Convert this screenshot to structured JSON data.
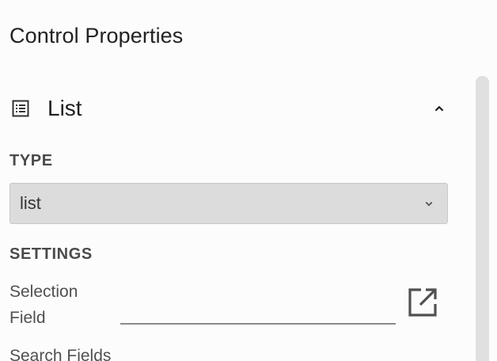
{
  "panel": {
    "title": "Control Properties"
  },
  "section": {
    "label": "List",
    "icon": "list-alt-icon",
    "collapse_icon": "chevron-up-icon"
  },
  "type_group": {
    "label": "TYPE",
    "select_value": "list",
    "select_icon": "chevron-down-icon"
  },
  "settings_group": {
    "label": "SETTINGS",
    "selection_field": {
      "label": "Selection Field",
      "value": "",
      "action_icon": "open-in-new-icon"
    },
    "search_fields": {
      "label": "Search Fields"
    }
  },
  "colors": {
    "background": "#fcfcfc",
    "select_background": "#dcdcdc",
    "scrollbar": "#e0e0e0"
  }
}
